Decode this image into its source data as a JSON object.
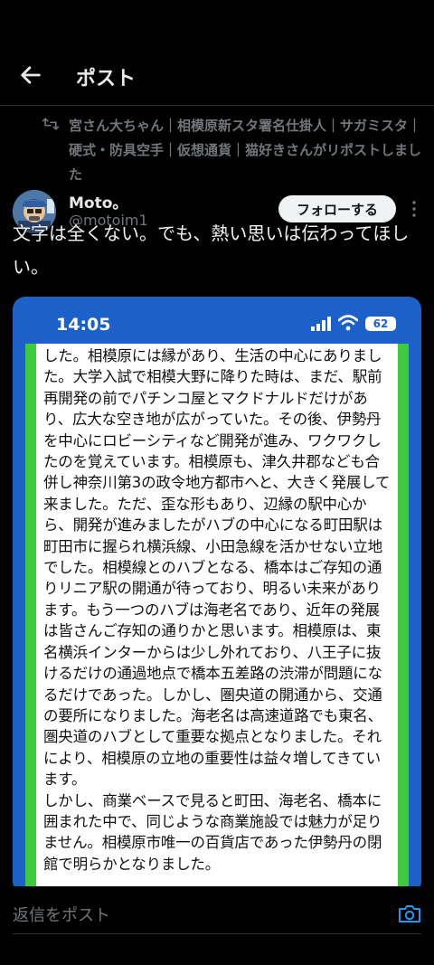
{
  "header": {
    "title": "ポスト"
  },
  "repost": {
    "text": "宮さん大ちゃん｜相模原新スタ署名仕掛人｜サガミスタ｜硬式・防具空手｜仮想通貨｜猫好きさんがリポストしました"
  },
  "author": {
    "name": "Moto。",
    "handle": "@motoim1",
    "follow_label": "フォローする"
  },
  "post": {
    "text": "文字は全くない。でも、熱い思いは伝わってほしい。"
  },
  "screenshot": {
    "time": "14:05",
    "battery": "62",
    "body": "した。相模原には縁があり、生活の中心にありました。大学入試で相模大野に降りた時は、まだ、駅前再開発の前でパチンコ屋とマクドナルドだけがあり、広大な空き地が広がっていた。その後、伊勢丹を中心にロビーシティなど開発が進み、ワクワクしたのを覚えています。相模原も、津久井郡なども合併し神奈川第3の政令地方都市へと、大きく発展して来ました。ただ、歪な形もあり、辺縁の駅中心から、開発が進みましたがハブの中心になる町田駅は町田市に握られ横浜線、小田急線を活かせない立地でした。相模線とのハブとなる、橋本はご存知の通りリニア駅の開通が待っており、明るい未来があります。もう一つのハブは海老名であり、近年の発展は皆さんご存知の通りかと思います。相模原は、東名横浜インターからは少し外れており、八王子に抜けるだけの通過地点で橋本五差路の渋滞が問題になるだけであった。しかし、圏央道の開通から、交通の要所になりました。海老名は高速道路でも東名、圏央道のハブとして重要な拠点となりました。それにより、相模原の立地の重要性は益々増してきています。\nしかし、商業ベースで見ると町田、海老名、橋本に囲まれた中で、同じような商業施設では魅力が足りません。相模原市唯一の百貨店であった伊勢丹の閉館で明らかとなりました。"
  },
  "reply": {
    "placeholder": "返信をポスト"
  },
  "colors": {
    "background": "#000000",
    "accent": "#1d9bf0",
    "screenshot_blue": "#1c61c9",
    "frame_green": "#3fc93c"
  },
  "icons": [
    "back-arrow-icon",
    "repost-icon",
    "more-options-icon",
    "signal-icon",
    "wifi-icon",
    "battery-icon",
    "camera-icon"
  ]
}
